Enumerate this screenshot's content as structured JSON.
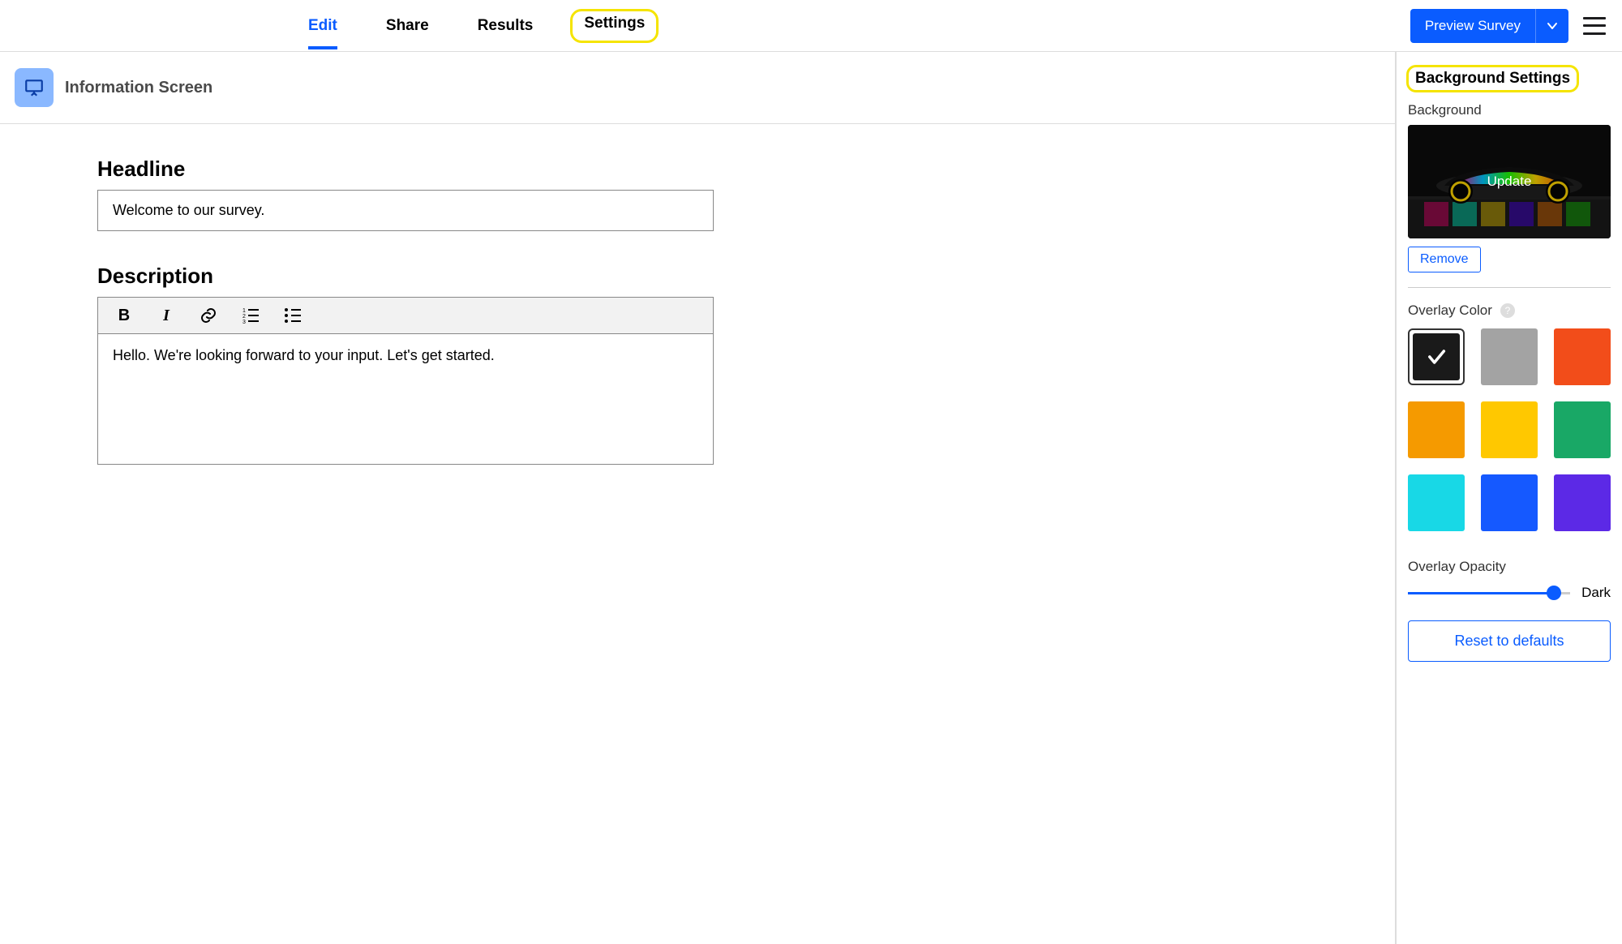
{
  "topbar": {
    "tabs": [
      "Edit",
      "Share",
      "Results",
      "Settings"
    ],
    "active_tab": "Edit",
    "highlighted_tab": "Settings",
    "preview_label": "Preview Survey"
  },
  "screen": {
    "title": "Information Screen"
  },
  "form": {
    "headline_label": "Headline",
    "headline_value": "Welcome to our survey.",
    "description_label": "Description",
    "description_value": "Hello. We're looking forward to your input. Let's get started."
  },
  "panel": {
    "header": "Background Settings",
    "background_label": "Background",
    "update_text": "Update",
    "remove_label": "Remove",
    "overlay_color_label": "Overlay Color",
    "overlay_colors": [
      {
        "color": "#1a1a1a",
        "selected": true
      },
      {
        "color": "#a3a3a3",
        "selected": false
      },
      {
        "color": "#f24d1a",
        "selected": false
      },
      {
        "color": "#f59a00",
        "selected": false
      },
      {
        "color": "#ffc800",
        "selected": false
      },
      {
        "color": "#19a866",
        "selected": false
      },
      {
        "color": "#18d8e6",
        "selected": false
      },
      {
        "color": "#1559ff",
        "selected": false
      },
      {
        "color": "#5c29e6",
        "selected": false
      }
    ],
    "overlay_opacity_label": "Overlay Opacity",
    "opacity_percent": 90,
    "opacity_text_label": "Dark",
    "reset_label": "Reset to defaults"
  }
}
